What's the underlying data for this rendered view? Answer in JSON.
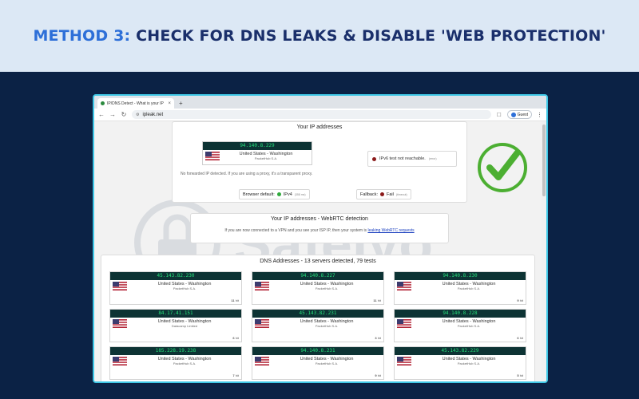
{
  "banner": {
    "title_accent": "METHOD 3:",
    "title_rest": " CHECK FOR DNS LEAKS & DISABLE 'WEB PROTECTION'"
  },
  "browser": {
    "tab_title": "IP/DNS Detect - What is your IP",
    "tab_close": "×",
    "new_tab": "+",
    "url": "ipleak.net",
    "guest_label": "Guest",
    "menu": "⋮"
  },
  "ip_section": {
    "title": "Your IP addresses",
    "ip": "94.140.8.229",
    "location": "United States - Washington",
    "isp": "PacketHub S.A.",
    "no_forward": "No forwarded IP detected. If you are using a proxy, it's a transparent proxy.",
    "ipv6_text": "IPv6 test not reachable.",
    "ipv6_note": "(error)",
    "browser_default_label": "Browser default:",
    "browser_default_value": "IPv4",
    "browser_default_note": "(358 ms)",
    "fallback_label": "Fallback:",
    "fallback_value": "Fail",
    "fallback_note": "(timeout)"
  },
  "webrtc": {
    "title": "Your IP addresses - WebRTC detection",
    "note": "If you are now connected to a VPN and you see your ISP IP, then your system is",
    "link": "leaking WebRTC requests"
  },
  "watermark": {
    "text": "Safelyo"
  },
  "dns": {
    "title": "DNS Addresses - 13 servers detected, 79 tests",
    "hits_suffix": "hit",
    "servers": [
      {
        "ip": "45.143.82.230",
        "location": "United States - Washington",
        "isp": "PacketHub S.A.",
        "hits": "11"
      },
      {
        "ip": "94.140.8.227",
        "location": "United States - Washington",
        "isp": "PacketHub S.A.",
        "hits": "11"
      },
      {
        "ip": "94.140.8.230",
        "location": "United States - Washington",
        "isp": "PacketHub S.A.",
        "hits": "9"
      },
      {
        "ip": "84.17.41.151",
        "location": "United States - Washington",
        "isp": "Datacamp Limited",
        "hits": "6"
      },
      {
        "ip": "45.143.82.231",
        "location": "United States - Washington",
        "isp": "PacketHub S.A.",
        "hits": "3"
      },
      {
        "ip": "94.140.8.228",
        "location": "United States - Washington",
        "isp": "PacketHub S.A.",
        "hits": "6"
      },
      {
        "ip": "185.228.19.238",
        "location": "United States - Washington",
        "isp": "PacketHub S.A.",
        "hits": "7"
      },
      {
        "ip": "94.140.8.231",
        "location": "United States - Washington",
        "isp": "PacketHub S.A.",
        "hits": "9"
      },
      {
        "ip": "45.143.82.229",
        "location": "United States - Washington",
        "isp": "PacketHub S.A.",
        "hits": "5"
      }
    ]
  },
  "colors": {
    "banner_bg": "#dce8f5",
    "banner_text": "#1a2f6b",
    "banner_accent": "#2d6fd8",
    "page_bg": "#0b2245",
    "ip_bar_bg": "#0d3334",
    "ip_text": "#25e07a",
    "check_green": "#4caf32"
  },
  "icons": {
    "flag": "us-flag-icon",
    "check": "green-check-circle-icon"
  }
}
